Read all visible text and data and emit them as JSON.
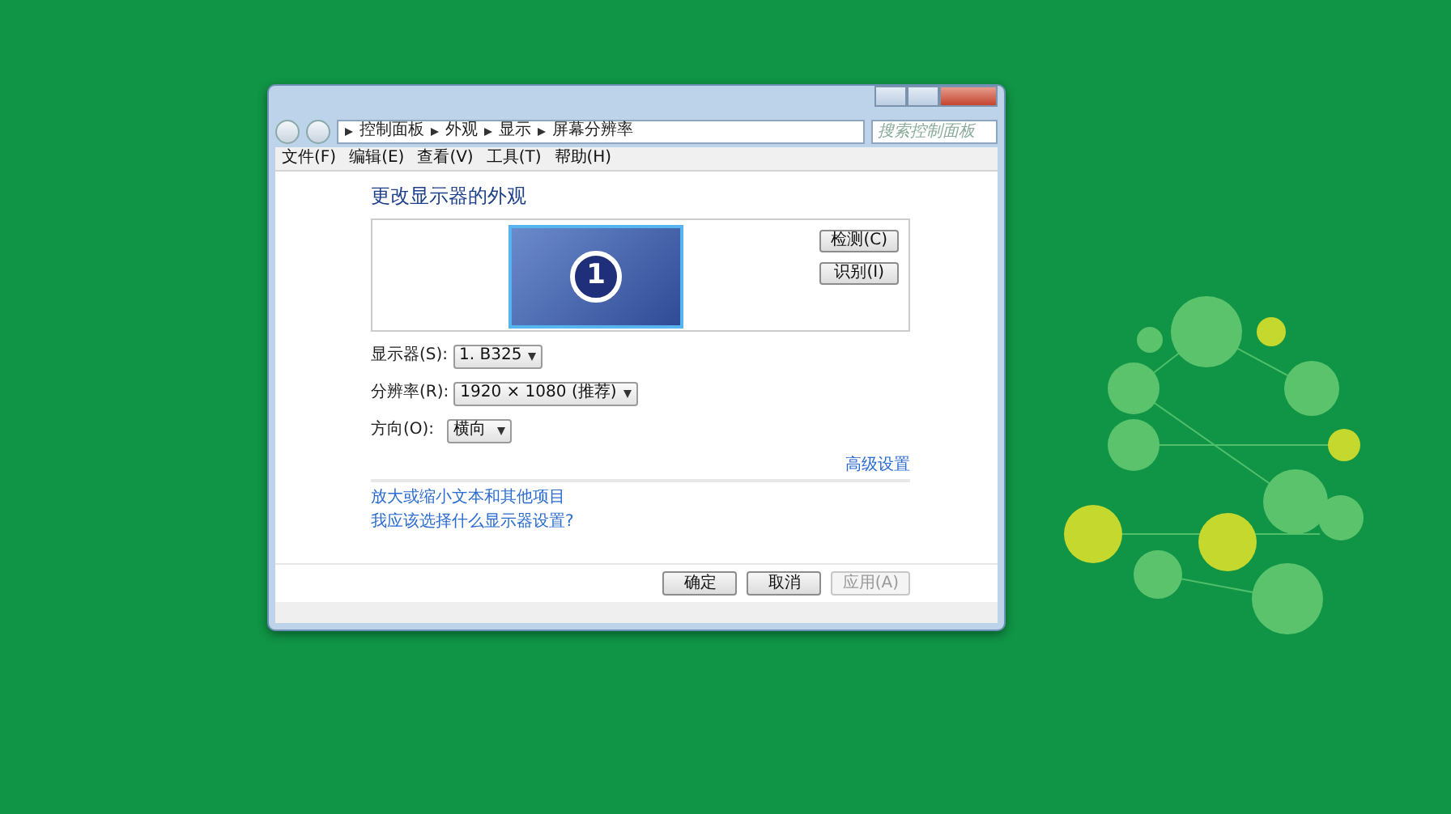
{
  "window": {
    "breadcrumb": [
      "控制面板",
      "外观",
      "显示",
      "屏幕分辨率"
    ],
    "search": {
      "placeholder": "搜索控制面板"
    },
    "menu": [
      "文件(F)",
      "编辑(E)",
      "查看(V)",
      "工具(T)",
      "帮助(H)"
    ]
  },
  "content": {
    "heading": "更改显示器的外观",
    "monitor_number": "1",
    "side_buttons": [
      "检测(C)",
      "识别(I)"
    ],
    "fields": [
      {
        "label": "显示器(S):",
        "value": "1. B325"
      },
      {
        "label": "分辨率(R):",
        "value": "1920 × 1080 (推荐)"
      },
      {
        "label": "方向(O):",
        "value": "横向"
      }
    ],
    "advanced_link": "高级设置",
    "links": [
      "放大或缩小文本和其他项目",
      "我应该选择什么显示器设置?"
    ]
  },
  "footer_buttons": [
    {
      "label": "确定",
      "disabled": false
    },
    {
      "label": "取消",
      "disabled": false
    },
    {
      "label": "应用(A)",
      "disabled": true
    }
  ]
}
